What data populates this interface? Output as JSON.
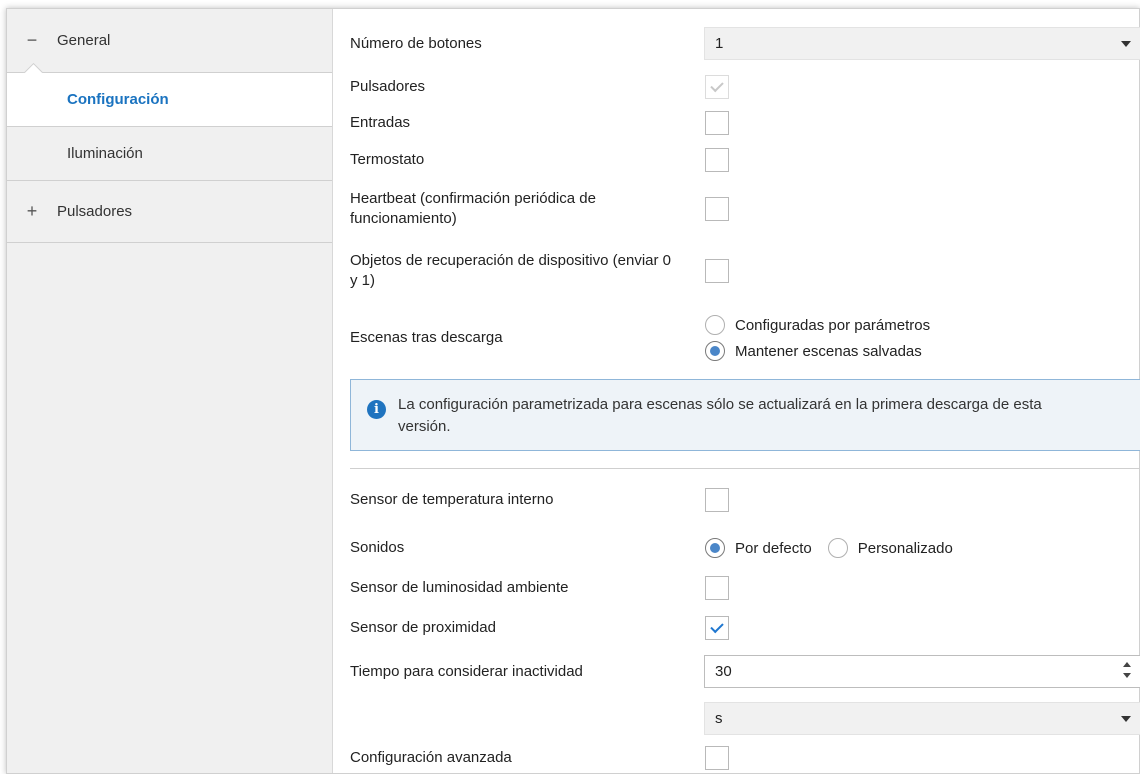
{
  "sidebar": {
    "general": {
      "sign": "−",
      "label": "General"
    },
    "items": [
      {
        "label": "Configuración",
        "active": true
      },
      {
        "label": "Iluminación",
        "active": false
      }
    ],
    "pulsadores": {
      "sign": "+",
      "label": "Pulsadores"
    }
  },
  "main": {
    "num_botones": {
      "label": "Número de botones",
      "value": "1"
    },
    "pulsadores": {
      "label": "Pulsadores",
      "checked": true
    },
    "entradas": {
      "label": "Entradas",
      "checked": false
    },
    "termostato": {
      "label": "Termostato",
      "checked": false
    },
    "heartbeat": {
      "label": "Heartbeat (confirmación periódica de funcionamiento)",
      "checked": false
    },
    "objetos": {
      "label": "Objetos de recuperación de dispositivo (enviar 0 y 1)",
      "checked": false
    },
    "escenas": {
      "label": "Escenas tras descarga",
      "options": [
        "Configuradas por parámetros",
        "Mantener escenas salvadas"
      ],
      "selected": "Mantener escenas salvadas"
    },
    "info": {
      "icon": "info-icon",
      "text": "La configuración parametrizada para escenas sólo se actualizará en la primera descarga de esta versión."
    },
    "sensor_temp": {
      "label": "Sensor de temperatura interno",
      "checked": false
    },
    "sonidos": {
      "label": "Sonidos",
      "options": [
        "Por defecto",
        "Personalizado"
      ],
      "selected": "Por defecto"
    },
    "sensor_lum": {
      "label": "Sensor de luminosidad ambiente",
      "checked": false
    },
    "sensor_prox": {
      "label": "Sensor de proximidad",
      "checked": true
    },
    "tiempo": {
      "label": "Tiempo para considerar inactividad",
      "value": "30"
    },
    "unidad": {
      "value": "s"
    },
    "avanzada": {
      "label": "Configuración avanzada",
      "checked": false
    }
  },
  "colors": {
    "accent": "#1a73c0",
    "radio_dot": "#4a86c8",
    "info_border": "#8fb6d9"
  }
}
